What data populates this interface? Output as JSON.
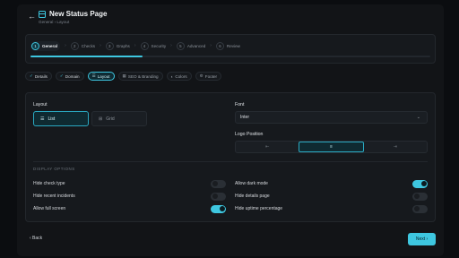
{
  "header": {
    "back_icon": "←",
    "title": "New Status Page",
    "breadcrumb": "General › Layout"
  },
  "steps": [
    {
      "num": "1",
      "label": "General",
      "active": true
    },
    {
      "num": "2",
      "label": "Checks"
    },
    {
      "num": "3",
      "label": "Graphs"
    },
    {
      "num": "4",
      "label": "Security"
    },
    {
      "num": "5",
      "label": "Advanced"
    },
    {
      "num": "6",
      "label": "Review"
    }
  ],
  "progress_fraction": 0.28,
  "tabs": [
    {
      "label": "Details",
      "icon": "✓",
      "state": "done"
    },
    {
      "label": "Domain",
      "icon": "✓",
      "state": "done"
    },
    {
      "label": "Layout",
      "icon": "☰",
      "state": "active"
    },
    {
      "label": "SEO & Branding",
      "icon": "▦",
      "state": ""
    },
    {
      "label": "Colors",
      "icon": "◐",
      "state": ""
    },
    {
      "label": "Footer",
      "icon": "⚙",
      "state": ""
    }
  ],
  "layout": {
    "label": "Layout",
    "options": [
      {
        "label": "List",
        "icon": "☰"
      },
      {
        "label": "Grid",
        "icon": "⊞"
      }
    ],
    "selected": "List"
  },
  "font": {
    "label": "Font",
    "value": "Inter"
  },
  "logo_position": {
    "label": "Logo Position",
    "options": [
      "left",
      "center",
      "right"
    ],
    "selected": "center"
  },
  "display_options": {
    "heading": "DISPLAY OPTIONS",
    "left": [
      {
        "label": "Hide check type",
        "on": false
      },
      {
        "label": "Hide recent incidents",
        "on": false
      },
      {
        "label": "Allow full screen",
        "on": true
      }
    ],
    "right": [
      {
        "label": "Allow dark mode",
        "on": true
      },
      {
        "label": "Hide details page",
        "on": false
      },
      {
        "label": "Hide uptime percentage",
        "on": false
      }
    ]
  },
  "footer": {
    "back_label": "‹  Back",
    "next_label": "Next  ›"
  },
  "colors": {
    "accent": "#3ec7e0",
    "background": "#0b0d10",
    "card": "#16191d"
  }
}
